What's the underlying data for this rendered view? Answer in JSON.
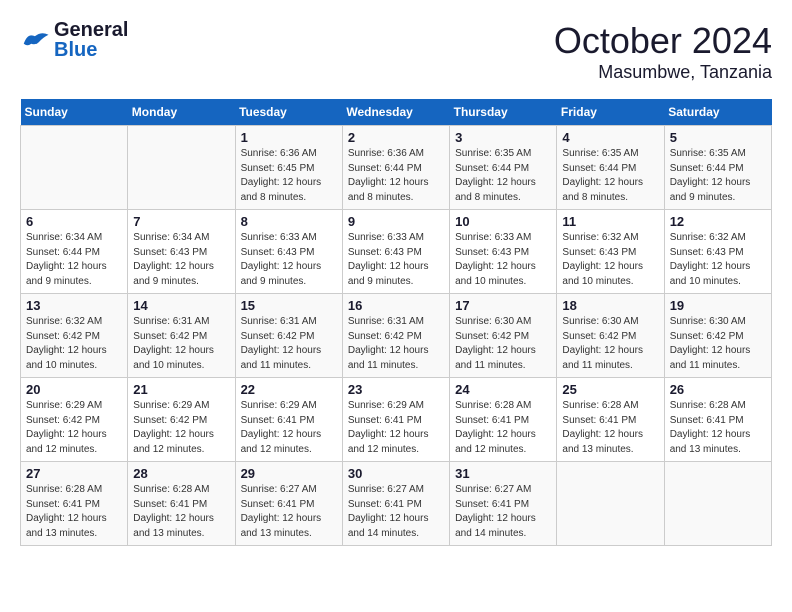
{
  "header": {
    "logo_general": "General",
    "logo_blue": "Blue",
    "title": "October 2024",
    "subtitle": "Masumbwe, Tanzania"
  },
  "weekdays": [
    "Sunday",
    "Monday",
    "Tuesday",
    "Wednesday",
    "Thursday",
    "Friday",
    "Saturday"
  ],
  "weeks": [
    [
      {
        "day": "",
        "info": ""
      },
      {
        "day": "",
        "info": ""
      },
      {
        "day": "1",
        "info": "Sunrise: 6:36 AM\nSunset: 6:45 PM\nDaylight: 12 hours and 8 minutes."
      },
      {
        "day": "2",
        "info": "Sunrise: 6:36 AM\nSunset: 6:44 PM\nDaylight: 12 hours and 8 minutes."
      },
      {
        "day": "3",
        "info": "Sunrise: 6:35 AM\nSunset: 6:44 PM\nDaylight: 12 hours and 8 minutes."
      },
      {
        "day": "4",
        "info": "Sunrise: 6:35 AM\nSunset: 6:44 PM\nDaylight: 12 hours and 8 minutes."
      },
      {
        "day": "5",
        "info": "Sunrise: 6:35 AM\nSunset: 6:44 PM\nDaylight: 12 hours and 9 minutes."
      }
    ],
    [
      {
        "day": "6",
        "info": "Sunrise: 6:34 AM\nSunset: 6:44 PM\nDaylight: 12 hours and 9 minutes."
      },
      {
        "day": "7",
        "info": "Sunrise: 6:34 AM\nSunset: 6:43 PM\nDaylight: 12 hours and 9 minutes."
      },
      {
        "day": "8",
        "info": "Sunrise: 6:33 AM\nSunset: 6:43 PM\nDaylight: 12 hours and 9 minutes."
      },
      {
        "day": "9",
        "info": "Sunrise: 6:33 AM\nSunset: 6:43 PM\nDaylight: 12 hours and 9 minutes."
      },
      {
        "day": "10",
        "info": "Sunrise: 6:33 AM\nSunset: 6:43 PM\nDaylight: 12 hours and 10 minutes."
      },
      {
        "day": "11",
        "info": "Sunrise: 6:32 AM\nSunset: 6:43 PM\nDaylight: 12 hours and 10 minutes."
      },
      {
        "day": "12",
        "info": "Sunrise: 6:32 AM\nSunset: 6:43 PM\nDaylight: 12 hours and 10 minutes."
      }
    ],
    [
      {
        "day": "13",
        "info": "Sunrise: 6:32 AM\nSunset: 6:42 PM\nDaylight: 12 hours and 10 minutes."
      },
      {
        "day": "14",
        "info": "Sunrise: 6:31 AM\nSunset: 6:42 PM\nDaylight: 12 hours and 10 minutes."
      },
      {
        "day": "15",
        "info": "Sunrise: 6:31 AM\nSunset: 6:42 PM\nDaylight: 12 hours and 11 minutes."
      },
      {
        "day": "16",
        "info": "Sunrise: 6:31 AM\nSunset: 6:42 PM\nDaylight: 12 hours and 11 minutes."
      },
      {
        "day": "17",
        "info": "Sunrise: 6:30 AM\nSunset: 6:42 PM\nDaylight: 12 hours and 11 minutes."
      },
      {
        "day": "18",
        "info": "Sunrise: 6:30 AM\nSunset: 6:42 PM\nDaylight: 12 hours and 11 minutes."
      },
      {
        "day": "19",
        "info": "Sunrise: 6:30 AM\nSunset: 6:42 PM\nDaylight: 12 hours and 11 minutes."
      }
    ],
    [
      {
        "day": "20",
        "info": "Sunrise: 6:29 AM\nSunset: 6:42 PM\nDaylight: 12 hours and 12 minutes."
      },
      {
        "day": "21",
        "info": "Sunrise: 6:29 AM\nSunset: 6:42 PM\nDaylight: 12 hours and 12 minutes."
      },
      {
        "day": "22",
        "info": "Sunrise: 6:29 AM\nSunset: 6:41 PM\nDaylight: 12 hours and 12 minutes."
      },
      {
        "day": "23",
        "info": "Sunrise: 6:29 AM\nSunset: 6:41 PM\nDaylight: 12 hours and 12 minutes."
      },
      {
        "day": "24",
        "info": "Sunrise: 6:28 AM\nSunset: 6:41 PM\nDaylight: 12 hours and 12 minutes."
      },
      {
        "day": "25",
        "info": "Sunrise: 6:28 AM\nSunset: 6:41 PM\nDaylight: 12 hours and 13 minutes."
      },
      {
        "day": "26",
        "info": "Sunrise: 6:28 AM\nSunset: 6:41 PM\nDaylight: 12 hours and 13 minutes."
      }
    ],
    [
      {
        "day": "27",
        "info": "Sunrise: 6:28 AM\nSunset: 6:41 PM\nDaylight: 12 hours and 13 minutes."
      },
      {
        "day": "28",
        "info": "Sunrise: 6:28 AM\nSunset: 6:41 PM\nDaylight: 12 hours and 13 minutes."
      },
      {
        "day": "29",
        "info": "Sunrise: 6:27 AM\nSunset: 6:41 PM\nDaylight: 12 hours and 13 minutes."
      },
      {
        "day": "30",
        "info": "Sunrise: 6:27 AM\nSunset: 6:41 PM\nDaylight: 12 hours and 14 minutes."
      },
      {
        "day": "31",
        "info": "Sunrise: 6:27 AM\nSunset: 6:41 PM\nDaylight: 12 hours and 14 minutes."
      },
      {
        "day": "",
        "info": ""
      },
      {
        "day": "",
        "info": ""
      }
    ]
  ]
}
